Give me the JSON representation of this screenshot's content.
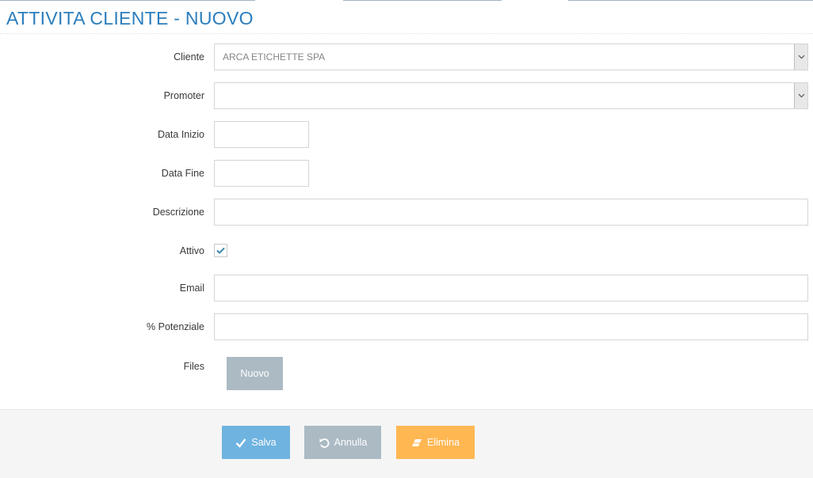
{
  "page": {
    "title": "ATTIVITA CLIENTE - NUOVO"
  },
  "form": {
    "cliente": {
      "label": "Cliente",
      "value": "ARCA ETICHETTE SPA"
    },
    "promoter": {
      "label": "Promoter",
      "value": ""
    },
    "data_inizio": {
      "label": "Data Inizio",
      "value": ""
    },
    "data_fine": {
      "label": "Data Fine",
      "value": ""
    },
    "descrizione": {
      "label": "Descrizione",
      "value": ""
    },
    "attivo": {
      "label": "Attivo",
      "checked": true
    },
    "email": {
      "label": "Email",
      "value": ""
    },
    "potenziale": {
      "label": "% Potenziale",
      "value": ""
    },
    "files": {
      "label": "Files",
      "button_label": "Nuovo"
    }
  },
  "actions": {
    "save_label": "Salva",
    "cancel_label": "Annulla",
    "delete_label": "Elimina"
  },
  "icons": {
    "select_arrow": "chevron-down-icon",
    "checkbox": "check-icon",
    "save": "check-icon",
    "cancel": "undo-icon",
    "delete": "eraser-icon"
  },
  "colors": {
    "title": "#2b7dbc",
    "save": "#6fb3e0",
    "cancel": "#abbac3",
    "delete": "#ffb752",
    "check": "#3a87ad",
    "footer_bg": "#f5f5f5"
  }
}
